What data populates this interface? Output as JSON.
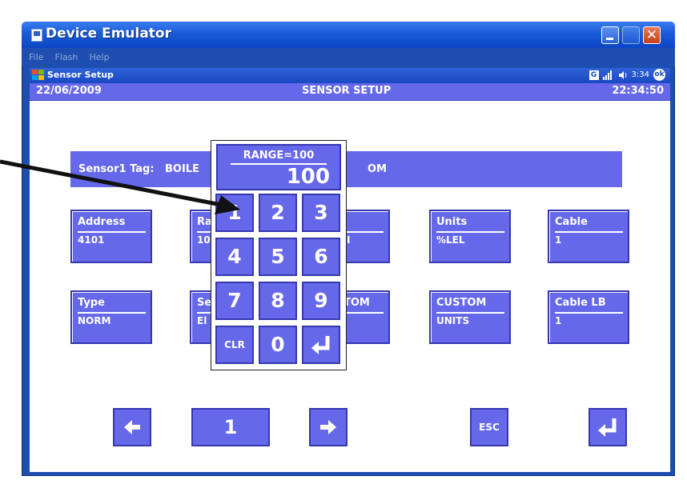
{
  "window": {
    "title": "Device Emulator",
    "close_glyph": "✕",
    "menu": [
      "File",
      "Flash",
      "Help"
    ]
  },
  "taskbar": {
    "app_title": "Sensor Setup",
    "time": "3:34",
    "ok_label": "ok",
    "g_label": "G"
  },
  "statusbar": {
    "date": "22/06/2009",
    "title": "SENSOR SETUP",
    "time": "22:34:50"
  },
  "tag": {
    "prefix": "Sensor1 Tag:",
    "value_left": "BOILE",
    "value_right": "OM"
  },
  "fields_row1": [
    {
      "label": "Address",
      "value": "4101"
    },
    {
      "label": "Ra",
      "value": "10"
    },
    {
      "label": "",
      "value": "I"
    },
    {
      "label": "Units",
      "value": "%LEL"
    },
    {
      "label": "Cable",
      "value": "1"
    }
  ],
  "fields_row2": [
    {
      "label": "Type",
      "value": "NORM"
    },
    {
      "label": "Se",
      "value": "El"
    },
    {
      "label": "TOM",
      "value": ""
    },
    {
      "label": "CUSTOM",
      "value": "UNITS"
    },
    {
      "label": "Cable LB",
      "value": "1"
    }
  ],
  "keypad": {
    "range_label": "RANGE=100",
    "value": "100",
    "keys": [
      "1",
      "2",
      "3",
      "4",
      "5",
      "6",
      "7",
      "8",
      "9",
      "CLR",
      "0",
      "↵"
    ]
  },
  "nav": {
    "prev_glyph": "◀",
    "page": "1",
    "next_glyph": "▶",
    "esc_label": "ESC",
    "enter_glyph": "↵"
  },
  "colors": {
    "button": "#6668ea",
    "button_border": "#3638b0",
    "window": "#1e4fb0"
  }
}
